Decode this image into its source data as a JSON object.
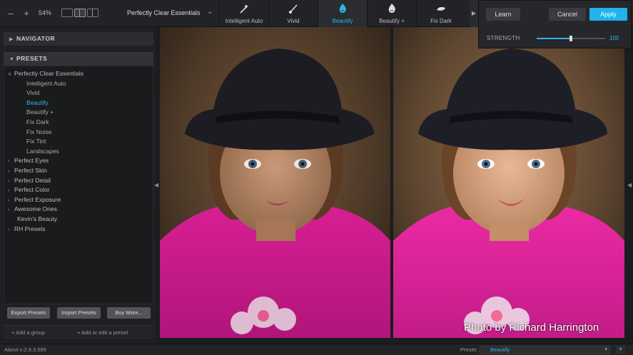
{
  "toolbar": {
    "zoom_out": "–",
    "zoom_in": "+",
    "zoom_level": "54%",
    "preset_group": "Perfectly Clear Essentials"
  },
  "preset_tabs": [
    {
      "label": "Intelligent Auto",
      "icon": "magic-wand-icon"
    },
    {
      "label": "Vivid",
      "icon": "brush-icon"
    },
    {
      "label": "Beautify",
      "icon": "beautify-drop-icon",
      "active": true
    },
    {
      "label": "Beautify +",
      "icon": "beautify-plus-icon"
    },
    {
      "label": "Fix Dark",
      "icon": "fix-dark-icon"
    }
  ],
  "strength_panel": {
    "learn": "Learn",
    "cancel": "Cancel",
    "apply": "Apply",
    "label": "STRENGTH",
    "value": "100",
    "fill_fraction": 0.5
  },
  "sidebar": {
    "navigator": "NAVIGATOR",
    "presets": "PRESETS",
    "tree": [
      {
        "label": "Perfectly Clear Essentials",
        "expanded": true,
        "level": 0
      },
      {
        "label": "Intelligent Auto",
        "level": 1
      },
      {
        "label": "Vivid",
        "level": 1
      },
      {
        "label": "Beautify",
        "level": 1,
        "selected": true
      },
      {
        "label": "Beautify +",
        "level": 1
      },
      {
        "label": "Fix Dark",
        "level": 1
      },
      {
        "label": "Fix Noise",
        "level": 1
      },
      {
        "label": "Fix Tint",
        "level": 1
      },
      {
        "label": "Landscapes",
        "level": 1
      },
      {
        "label": "Perfect Eyes",
        "level": 0
      },
      {
        "label": "Perfect Skin",
        "level": 0
      },
      {
        "label": "Perfect Detail",
        "level": 0
      },
      {
        "label": "Perfect Color",
        "level": 0
      },
      {
        "label": "Perfect Exposure",
        "level": 0
      },
      {
        "label": "Awesome Ones",
        "level": 0
      },
      {
        "label": "Kevin's Beauty",
        "level": 0,
        "noarrow": true
      },
      {
        "label": "RH Presets",
        "level": 0
      }
    ],
    "export_presets": "Export Presets",
    "import_presets": "Import Presets",
    "buy_more": "Buy More...",
    "add_group": "+ Add a group",
    "add_preset": "+ Add or edit a preset"
  },
  "photo_credit": "Photo by Richard Harrington",
  "footer": {
    "version": "About v:2.9.3.565",
    "preset_label": "Preset:",
    "preset_value": "Beautify",
    "add": "+"
  },
  "colors": {
    "accent": "#2fb5e8",
    "shirt": "#e0249a",
    "hat": "#1c1c22"
  }
}
